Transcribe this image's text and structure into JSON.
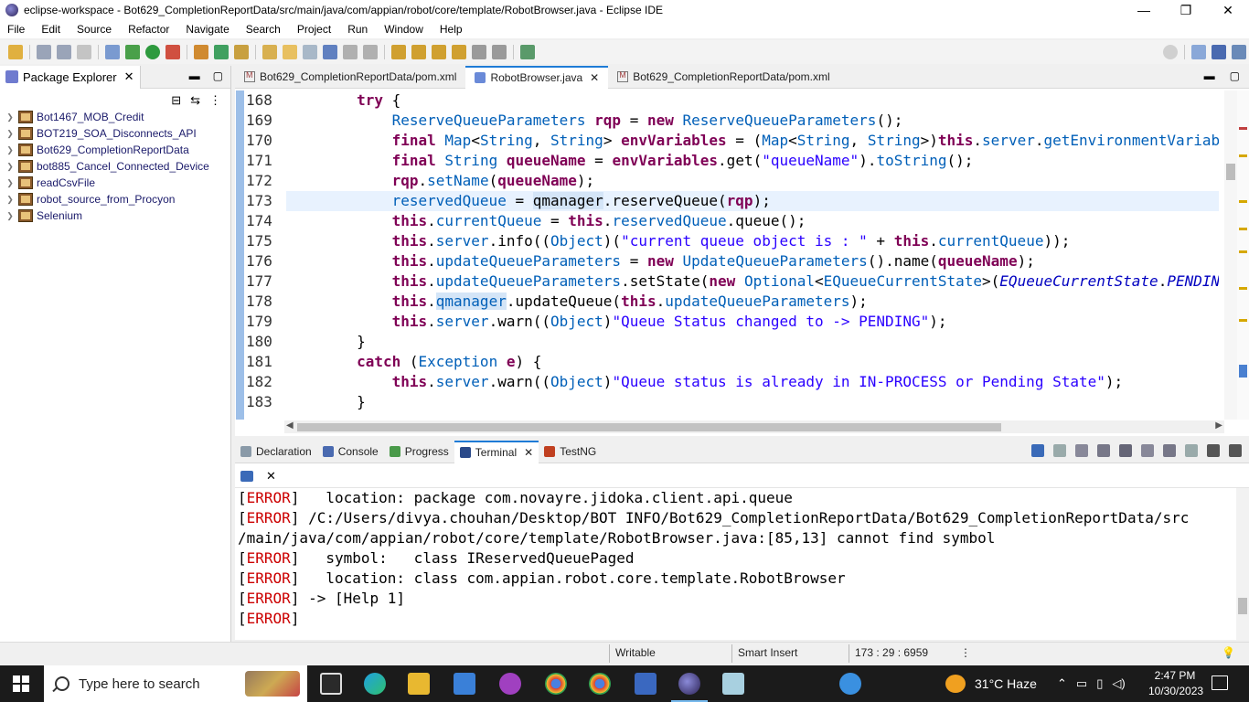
{
  "window": {
    "title": "eclipse-workspace - Bot629_CompletionReportData/src/main/java/com/appian/robot/core/template/RobotBrowser.java - Eclipse IDE",
    "min": "—",
    "restore": "❐",
    "close": "✕"
  },
  "menu": [
    "File",
    "Edit",
    "Source",
    "Refactor",
    "Navigate",
    "Search",
    "Project",
    "Run",
    "Window",
    "Help"
  ],
  "package_explorer": {
    "tab_label": "Package Explorer",
    "close": "✕",
    "items": [
      "Bot1467_MOB_Credit",
      "BOT219_SOA_Disconnects_API",
      "Bot629_CompletionReportData",
      "bot885_Cancel_Connected_Device",
      "readCsvFile",
      "robot_source_from_Procyon",
      "Selenium"
    ]
  },
  "editor": {
    "tabs": [
      {
        "label": "Bot629_CompletionReportData/pom.xml",
        "active": false
      },
      {
        "label": "RobotBrowser.java",
        "active": true
      },
      {
        "label": "Bot629_CompletionReportData/pom.xml",
        "active": false
      }
    ],
    "close": "✕",
    "line_numbers": [
      "168",
      "169",
      "170",
      "171",
      "172",
      "173",
      "174",
      "175",
      "176",
      "177",
      "178",
      "179",
      "180",
      "181",
      "182",
      "183"
    ],
    "current_line": "173"
  },
  "bottom_panel": {
    "tabs": [
      {
        "label": "Declaration",
        "active": false
      },
      {
        "label": "Console",
        "active": false
      },
      {
        "label": "Progress",
        "active": false
      },
      {
        "label": "Terminal",
        "active": true
      },
      {
        "label": "TestNG",
        "active": false
      }
    ],
    "close": "✕",
    "terminal_lines": [
      {
        "tag": "ERROR",
        "text": "   location: package com.novayre.jidoka.client.api.queue"
      },
      {
        "tag": "ERROR",
        "text": " /C:/Users/divya.chouhan/Desktop/BOT INFO/Bot629_CompletionReportData/Bot629_CompletionReportData/src"
      },
      {
        "tag": "",
        "text": "/main/java/com/appian/robot/core/template/RobotBrowser.java:[85,13] cannot find symbol"
      },
      {
        "tag": "ERROR",
        "text": "   symbol:   class IReservedQueuePaged"
      },
      {
        "tag": "ERROR",
        "text": "   location: class com.appian.robot.core.template.RobotBrowser"
      },
      {
        "tag": "ERROR",
        "text": " -> [Help 1]"
      },
      {
        "tag": "ERROR",
        "text": ""
      }
    ]
  },
  "status_bar": {
    "writable": "Writable",
    "insert_mode": "Smart Insert",
    "position": "173 : 29 : 6959",
    "menu": "⋮"
  },
  "taskbar": {
    "search_placeholder": "Type here to search",
    "weather": "31°C  Haze",
    "time": "2:47 PM",
    "date": "10/30/2023"
  },
  "colors": {
    "keyword": "#7f0055",
    "type": "#005fb8",
    "string": "#2a00ff",
    "error": "#cc0000",
    "accent": "#1e7bd6"
  }
}
